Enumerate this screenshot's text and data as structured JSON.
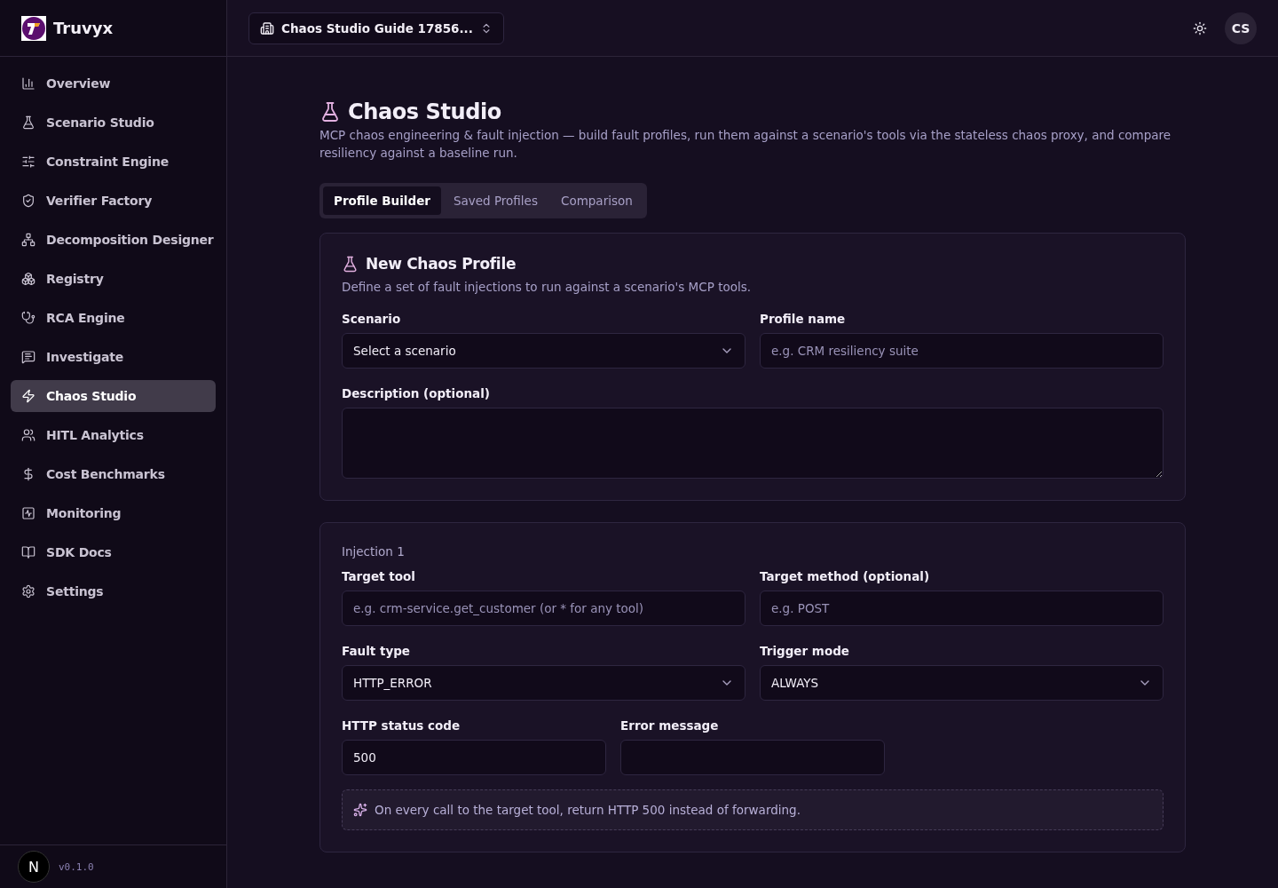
{
  "brand": {
    "name": "Truvyx"
  },
  "sidebar": {
    "items": [
      {
        "label": "Overview",
        "selected": false
      },
      {
        "label": "Scenario Studio",
        "selected": false
      },
      {
        "label": "Constraint Engine",
        "selected": false
      },
      {
        "label": "Verifier Factory",
        "selected": false
      },
      {
        "label": "Decomposition Designer",
        "selected": false
      },
      {
        "label": "Registry",
        "selected": false
      },
      {
        "label": "RCA Engine",
        "selected": false
      },
      {
        "label": "Investigate",
        "selected": false
      },
      {
        "label": "Chaos Studio",
        "selected": true
      },
      {
        "label": "HITL Analytics",
        "selected": false
      },
      {
        "label": "Cost Benchmarks",
        "selected": false
      },
      {
        "label": "Monitoring",
        "selected": false
      },
      {
        "label": "SDK Docs",
        "selected": false
      },
      {
        "label": "Settings",
        "selected": false
      }
    ],
    "version": "v0.1.0",
    "dev_badge": "N"
  },
  "topbar": {
    "workspace": "Chaos Studio Guide 17856...",
    "avatar": "CS"
  },
  "page": {
    "title": "Chaos Studio",
    "description": "MCP chaos engineering & fault injection — build fault profiles, run them against a scenario's tools via the stateless chaos proxy, and compare resiliency against a baseline run."
  },
  "tabs": [
    {
      "label": "Profile Builder",
      "selected": true
    },
    {
      "label": "Saved Profiles",
      "selected": false
    },
    {
      "label": "Comparison",
      "selected": false
    }
  ],
  "profile_card": {
    "title": "New Chaos Profile",
    "subtitle": "Define a set of fault injections to run against a scenario's MCP tools.",
    "fields": [
      {
        "kind": "select",
        "label": "Scenario",
        "value": "Select a scenario"
      },
      {
        "kind": "input",
        "label": "Profile name",
        "placeholder": "e.g. CRM resiliency suite"
      },
      {
        "kind": "textarea",
        "label": "Description (optional)"
      }
    ]
  },
  "injection": {
    "heading": "Injection 1",
    "fields": [
      {
        "kind": "input",
        "label": "Target tool",
        "placeholder": "e.g. crm-service.get_customer (or * for any tool)"
      },
      {
        "kind": "input",
        "label": "Target method (optional)",
        "placeholder": "e.g. POST"
      },
      {
        "kind": "select",
        "label": "Fault type",
        "value": "HTTP_ERROR"
      },
      {
        "kind": "select",
        "label": "Trigger mode",
        "value": "ALWAYS"
      }
    ],
    "small_fields": [
      {
        "label": "HTTP status code",
        "value": "500"
      },
      {
        "label": "Error message"
      }
    ],
    "hint": "On every call to the target tool, return HTTP 500 instead of forwarding."
  }
}
